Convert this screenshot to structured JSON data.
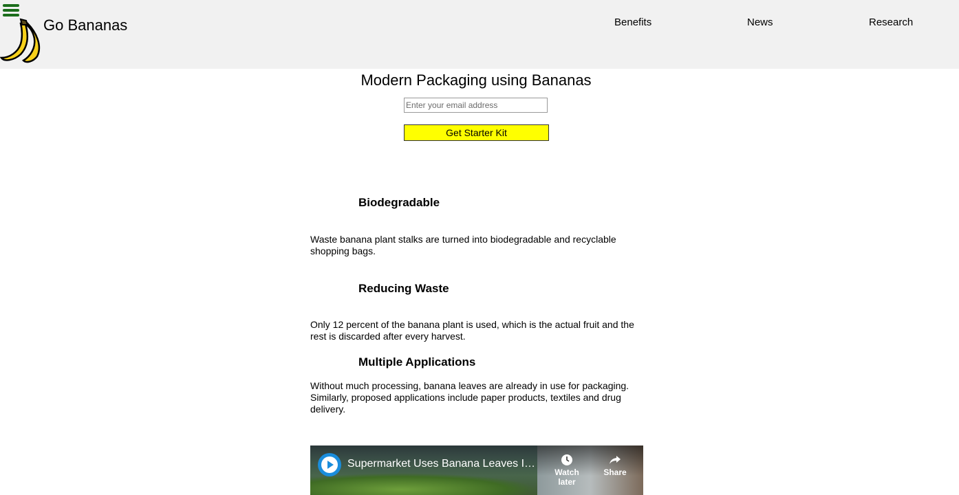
{
  "header": {
    "brand": "Go Bananas",
    "nav": [
      {
        "label": "Benefits"
      },
      {
        "label": "News"
      },
      {
        "label": "Research"
      }
    ]
  },
  "hero": {
    "title": "Modern Packaging using Bananas",
    "email_placeholder": "Enter your email address",
    "button_label": "Get Starter Kit"
  },
  "features": [
    {
      "heading": "Biodegradable",
      "text": "Waste banana plant stalks are turned into biodegradable and recyclable shopping bags."
    },
    {
      "heading": "Reducing Waste",
      "text": "Only 12 percent of the banana plant is used, which is the actual fruit and the rest is discarded after every harvest."
    },
    {
      "heading": "Multiple Applications",
      "text": "Without much processing, banana leaves are already in use for packaging. Similarly, proposed applications include paper products, textiles and drug delivery."
    }
  ],
  "video": {
    "title": "Supermarket Uses Banana Leaves Ins...",
    "watch_later": "Watch later",
    "share": "Share"
  },
  "colors": {
    "header_bg": "#f1f1f1",
    "menu_icon": "#1b6d1b",
    "button_bg": "#ffff00"
  },
  "icons": [
    "menu-icon",
    "banana-logo-icon",
    "play-icon",
    "clock-icon",
    "share-icon"
  ]
}
